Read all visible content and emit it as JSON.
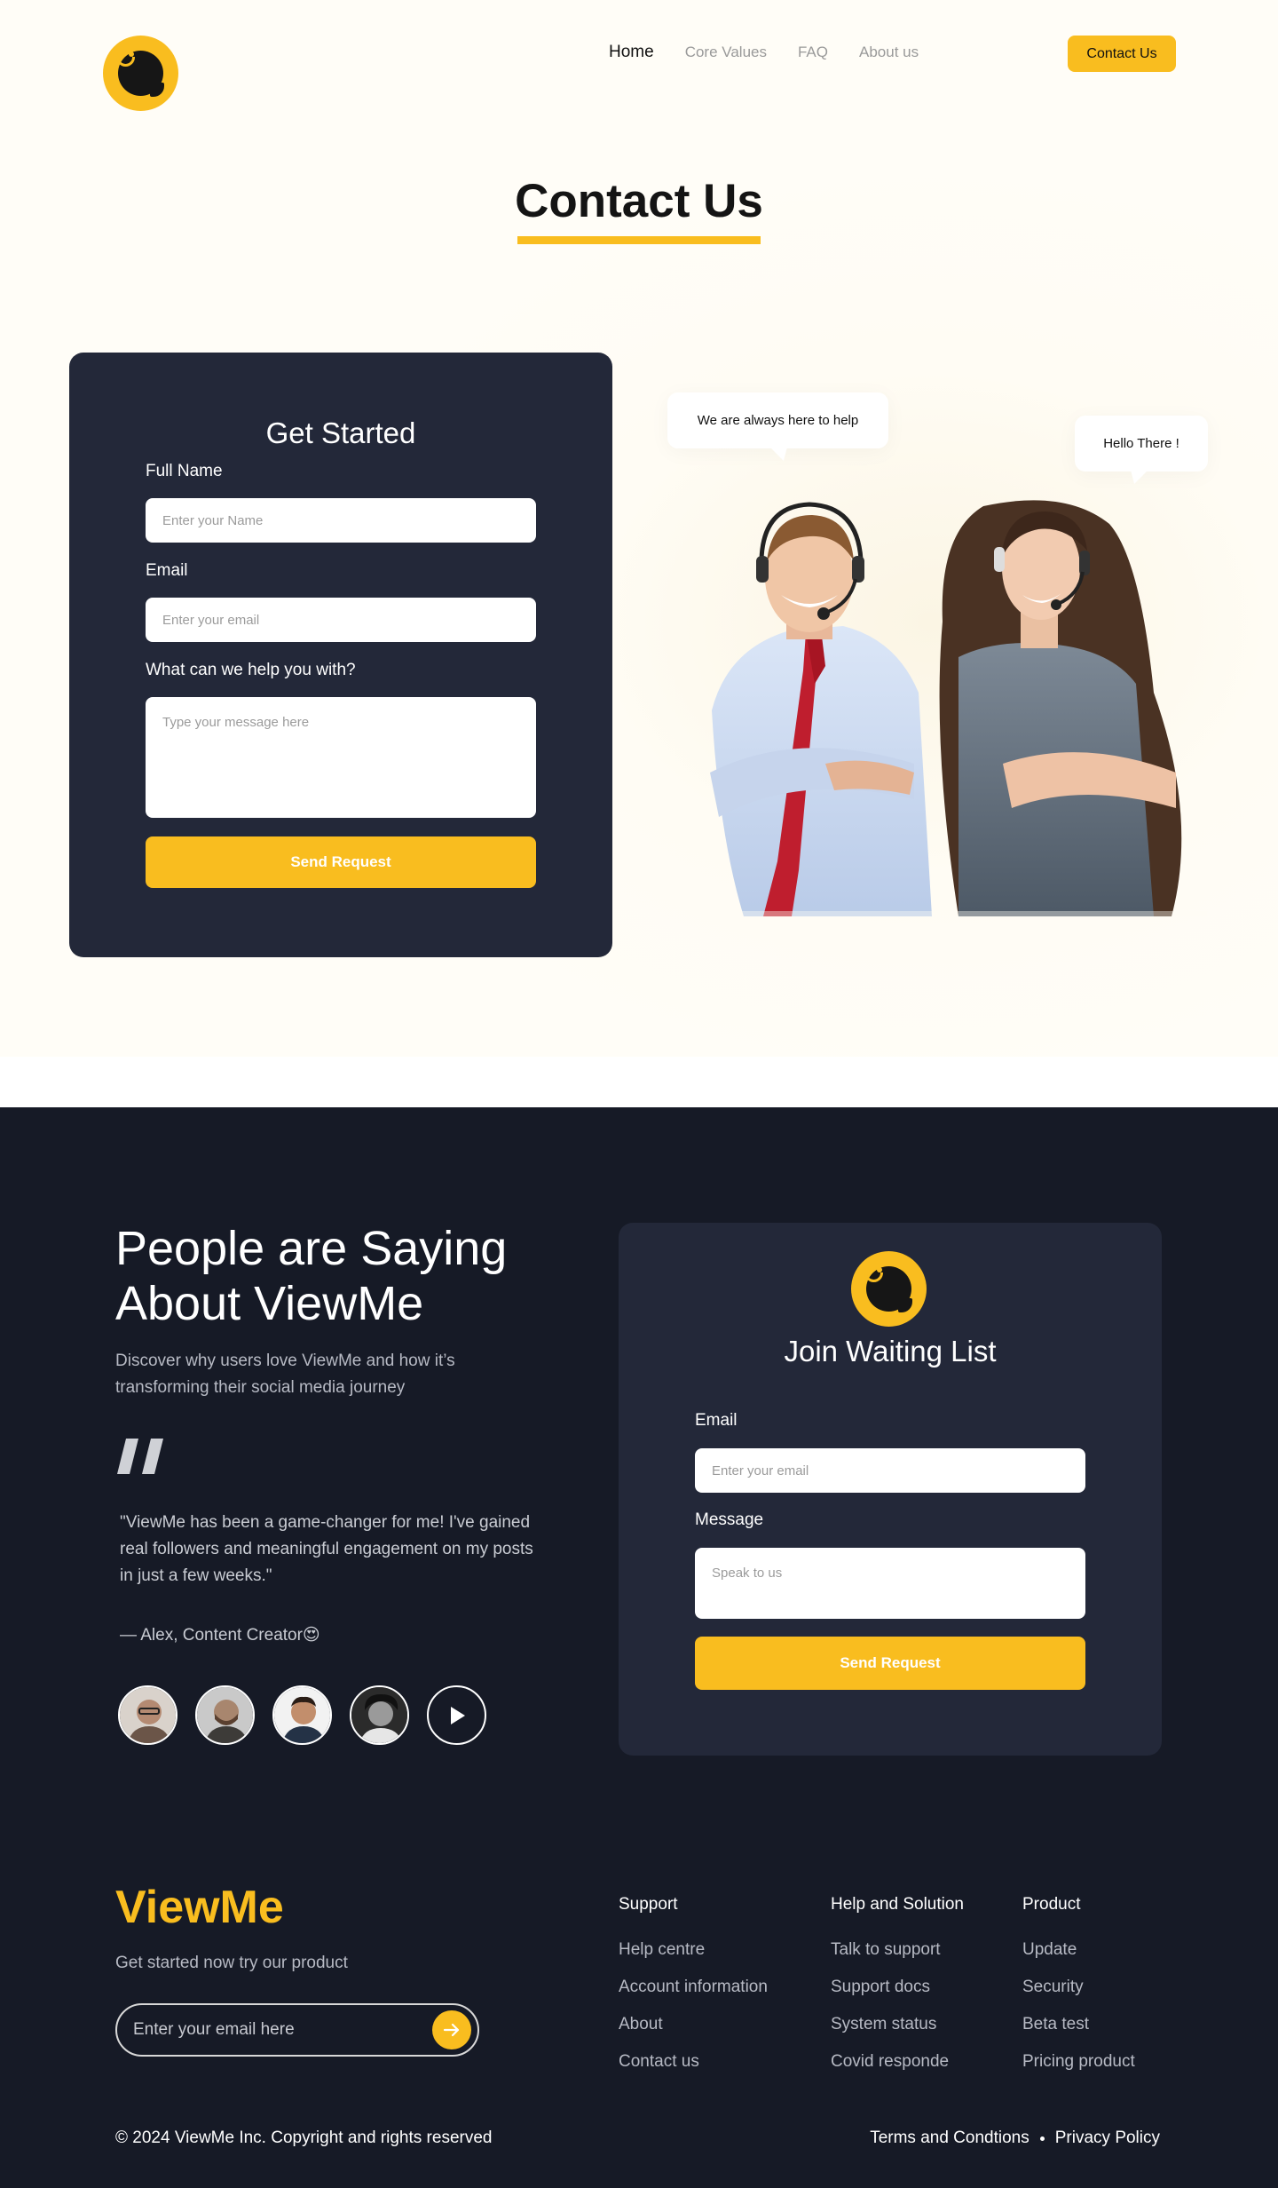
{
  "nav": {
    "items": [
      {
        "label": "Home",
        "active": true
      },
      {
        "label": "Core Values",
        "active": false
      },
      {
        "label": "FAQ",
        "active": false
      },
      {
        "label": "About us",
        "active": false
      }
    ],
    "cta_label": "Contact Us"
  },
  "hero": {
    "title": "Contact Us"
  },
  "contact_form": {
    "title": "Get Started",
    "name_label": "Full Name",
    "name_placeholder": "Enter your Name",
    "email_label": "Email",
    "email_placeholder": "Enter your email",
    "message_label": "What can we help you with?",
    "message_placeholder": "Type your message here",
    "submit_label": "Send Request"
  },
  "illustration": {
    "bubble_left": "We are always here to help",
    "bubble_right": "Hello There !"
  },
  "testimonials": {
    "title_line1": "People are Saying",
    "title_line2": "About ViewMe",
    "subtitle": "Discover why users love ViewMe and how it’s transforming their social media journey",
    "quote": "\"ViewMe has been a game-changer for me! I've gained real followers and meaningful engagement on my posts in just a few weeks.\"",
    "author": "— Alex, Content Creator😍",
    "avatars": [
      "avatar-1",
      "avatar-2",
      "avatar-3",
      "avatar-4"
    ]
  },
  "waitlist": {
    "title": "Join Waiting List",
    "email_label": "Email",
    "email_placeholder": "Enter your email",
    "message_label": "Message",
    "message_placeholder": "Speak to us",
    "submit_label": "Send Request"
  },
  "footer": {
    "brand": "ViewMe",
    "tagline": "Get started now try our product",
    "subscribe_placeholder": "Enter your email here",
    "columns": [
      {
        "heading": "Support",
        "links": [
          "Help centre",
          "Account information",
          "About",
          "Contact us"
        ]
      },
      {
        "heading": "Help and Solution",
        "links": [
          "Talk to support",
          "Support docs",
          "System status",
          "Covid responde"
        ]
      },
      {
        "heading": "Product",
        "links": [
          "Update",
          "Security",
          "Beta test",
          "Pricing product"
        ]
      }
    ],
    "copyright": "© 2024 ViewMe Inc. Copyright and rights reserved",
    "terms": "Terms and Condtions",
    "privacy": "Privacy Policy"
  },
  "colors": {
    "accent": "#f9bd1f",
    "card_bg": "#232839",
    "dark_bg": "#161a26"
  }
}
